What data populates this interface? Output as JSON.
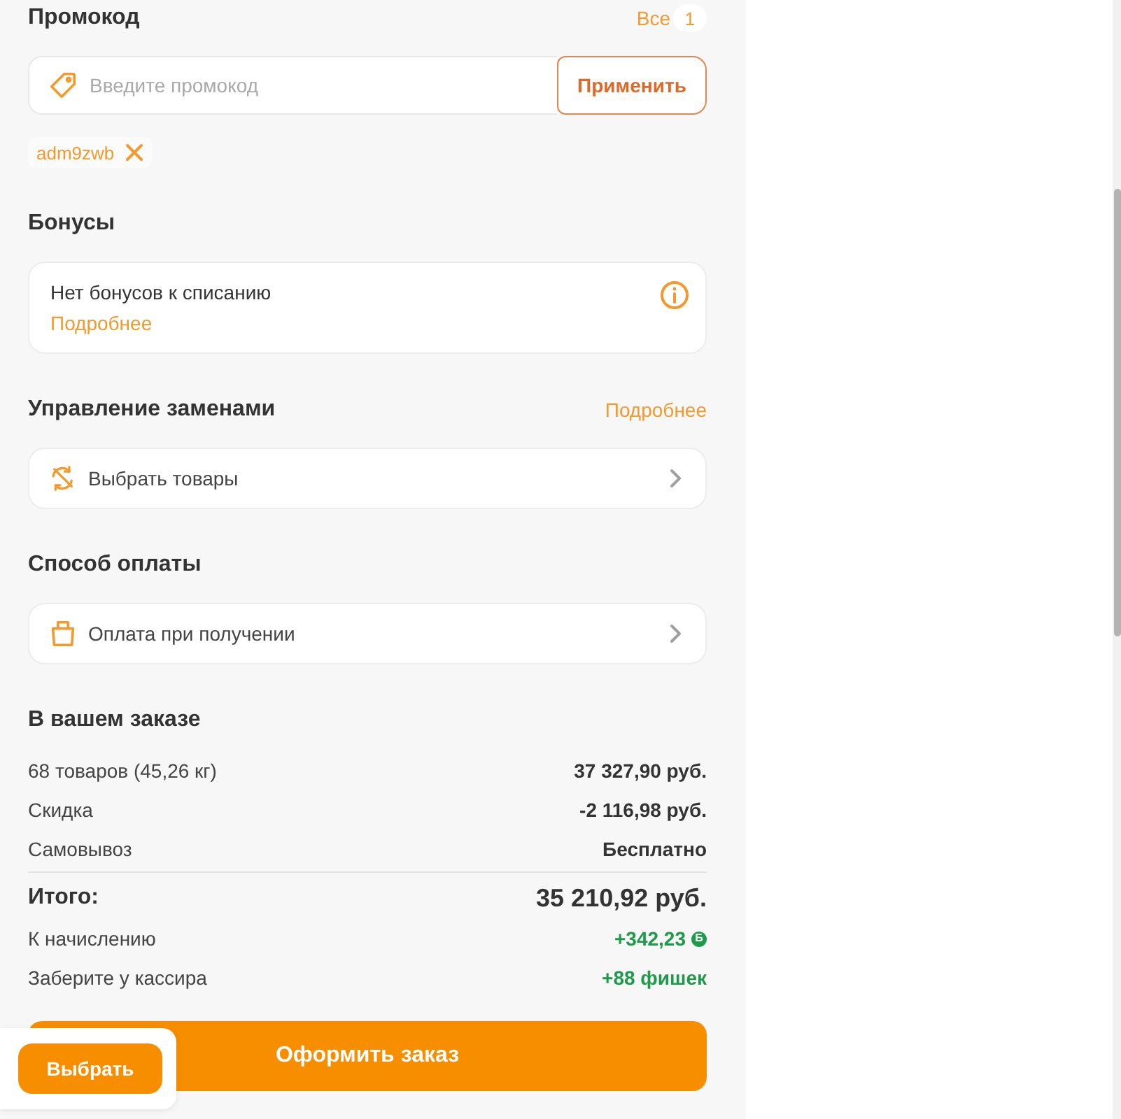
{
  "promo": {
    "title": "Промокод",
    "all_link": "Все",
    "count": "1",
    "input": {
      "placeholder": "Введите промокод"
    },
    "apply_button": "Применить",
    "applied_codes": [
      {
        "code": "adm9zwb"
      }
    ]
  },
  "bonuses": {
    "title": "Бонусы",
    "card": {
      "text": "Нет бонусов к списанию",
      "link": "Подробнее"
    }
  },
  "replacements": {
    "title": "Управление заменами",
    "link": "Подробнее",
    "row": {
      "label": "Выбрать товары"
    }
  },
  "payment": {
    "title": "Способ оплаты",
    "row": {
      "label": "Оплата при получении"
    }
  },
  "order_summary": {
    "title": "В вашем заказе",
    "rows": [
      {
        "kind": "line",
        "label": "68 товаров (45,26 кг)",
        "value": "37 327,90 руб."
      },
      {
        "kind": "line",
        "label": "Скидка",
        "value": "-2 116,98 руб."
      },
      {
        "kind": "line",
        "label": "Самовывоз",
        "value": "Бесплатно"
      },
      {
        "kind": "total",
        "label": "Итого:",
        "value": "35 210,92 руб."
      },
      {
        "kind": "credit",
        "label": "К начислению",
        "value": "+342,23",
        "coin": "Б"
      },
      {
        "kind": "credit",
        "label": "Заберите у кассира",
        "value": "+88 фишек"
      }
    ]
  },
  "checkout_button": "Оформить заказ",
  "floating_panel": {
    "button": "Выбрать"
  }
}
